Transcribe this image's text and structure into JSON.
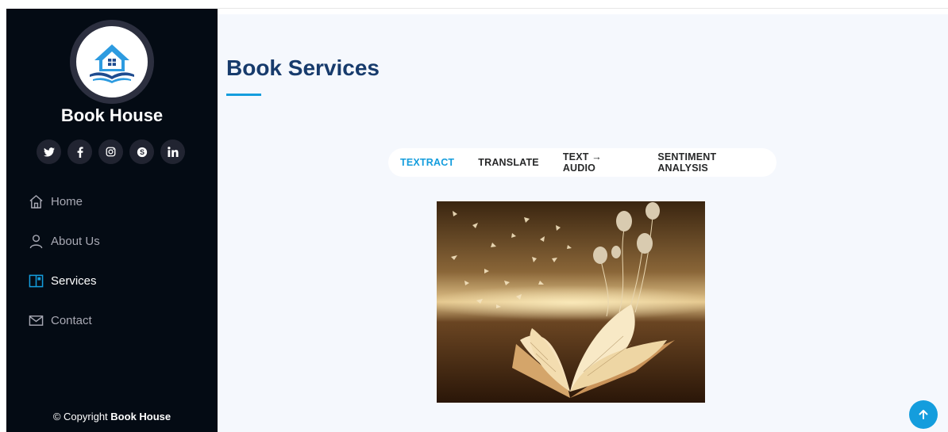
{
  "sidebar": {
    "brand": "Book House",
    "social": [
      {
        "icon": "twitter-icon",
        "glyph": "𝕏"
      },
      {
        "icon": "facebook-icon",
        "glyph": "f"
      },
      {
        "icon": "instagram-icon",
        "glyph": "◎"
      },
      {
        "icon": "skype-icon",
        "glyph": "S"
      },
      {
        "icon": "linkedin-icon",
        "glyph": "in"
      }
    ],
    "nav": [
      {
        "label": "Home",
        "icon": "home-icon"
      },
      {
        "label": "About Us",
        "icon": "person-icon"
      },
      {
        "label": "Services",
        "icon": "book-half-icon",
        "active": true
      },
      {
        "label": "Contact",
        "icon": "envelope-icon"
      }
    ],
    "copyright_prefix": "© Copyright ",
    "copyright_brand": "Book House"
  },
  "main": {
    "title": "Book Services",
    "tabs": [
      {
        "label": "TEXTRACT",
        "active": true
      },
      {
        "label": "TRANSLATE"
      },
      {
        "label": "TEXT → AUDIO"
      },
      {
        "label": "SENTIMENT ANALYSIS"
      }
    ]
  },
  "colors": {
    "sidebar_bg": "#040b14",
    "accent": "#149ddd",
    "title": "#173b6c",
    "main_bg": "#f5f8fd"
  }
}
